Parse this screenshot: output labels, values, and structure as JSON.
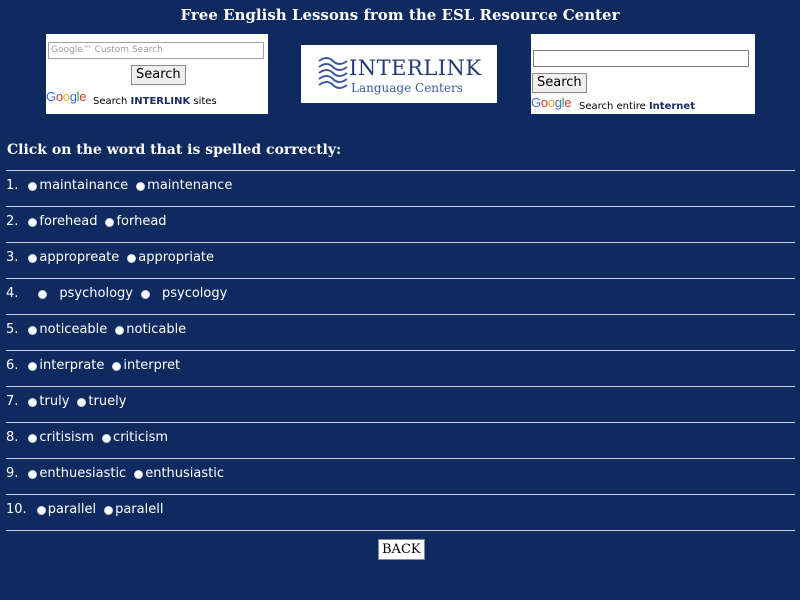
{
  "header": {
    "title": "Free English Lessons from the ESL Resource Center"
  },
  "search_left": {
    "placeholder": "Google™ Custom Search",
    "button": "Search",
    "caption_prefix": "Search ",
    "caption_bold": "INTERLINK",
    "caption_suffix": " sites"
  },
  "logo": {
    "name": "INTERLINK",
    "sub": "Language Centers"
  },
  "search_right": {
    "button": "Search",
    "caption_prefix": "Search entire ",
    "caption_bold": "Internet"
  },
  "google": {
    "g1": "G",
    "o1": "o",
    "o2": "o",
    "g2": "g",
    "l": "l",
    "e": "e"
  },
  "quiz": {
    "instruction": "Click on the word that is spelled correctly:",
    "questions": [
      {
        "num": "1.",
        "a": "maintainance",
        "b": "maintenance"
      },
      {
        "num": "2.",
        "a": "forehead",
        "b": "forhead"
      },
      {
        "num": "3.",
        "a": "appropreate",
        "b": "appropriate"
      },
      {
        "num": "4.",
        "a": "psychology",
        "b": "psycology"
      },
      {
        "num": "5.",
        "a": "noticeable",
        "b": "noticable"
      },
      {
        "num": "6.",
        "a": "interprate",
        "b": "interpret"
      },
      {
        "num": "7.",
        "a": "truly",
        "b": "truely"
      },
      {
        "num": "8.",
        "a": "critisism",
        "b": "criticism"
      },
      {
        "num": "9.",
        "a": "enthuesiastic",
        "b": "enthusiastic"
      },
      {
        "num": "10.",
        "a": "parallel",
        "b": "paralell"
      }
    ],
    "back": "BACK"
  }
}
